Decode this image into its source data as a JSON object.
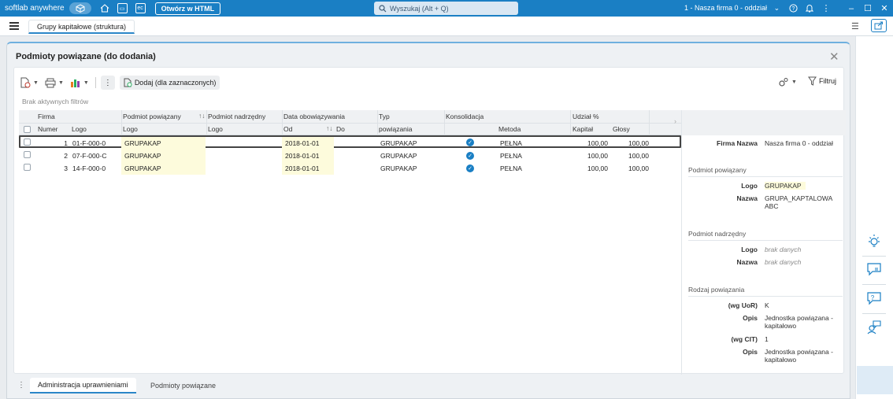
{
  "titlebar": {
    "brand": "softlab anywhere",
    "open_html": "Otwórz w HTML",
    "search_placeholder": "Wyszukaj (Alt + Q)",
    "company": "1 - Nasza firma 0 - oddział",
    "icons": [
      "cube-icon",
      "home-icon",
      "screen-icon",
      "ec-icon",
      "help-icon",
      "bell-icon",
      "more-icon",
      "minimize-icon",
      "maximize-icon",
      "close-icon"
    ]
  },
  "tabs": {
    "main_tab": "Grupy kapitałowe (struktura)"
  },
  "dialog": {
    "title": "Podmioty powiązane (do dodania)",
    "toolbar": {
      "add_label": "Dodaj (dla zaznaczonych)",
      "filter_label": "Filtruj"
    },
    "no_filters": "Brak aktywnych filtrów",
    "grid": {
      "header_top": {
        "firma": "Firma",
        "podmiot_powiazany": "Podmiot powiązany",
        "podmiot_nadrzedny": "Podmiot nadrzędny",
        "data_obowiazywania": "Data obowiązywania",
        "typ": "Typ",
        "konsolidacja": "Konsolidacja",
        "udzial": "Udział %"
      },
      "header_bottom": {
        "numer": "Numer",
        "logo1": "Logo",
        "logo2": "Logo",
        "logo3": "Logo",
        "od": "Od",
        "do": "Do",
        "powiazania": "powiązania",
        "metoda": "Metoda",
        "kapital": "Kapitał",
        "glosy": "Głosy"
      },
      "rows": [
        {
          "numer": "1",
          "firma_logo": "01-F-000-0",
          "pp_logo": "GRUPAKAP",
          "pn_logo": "",
          "od": "2018-01-01",
          "do": "",
          "typ": "GRUPAKAP",
          "konsolidacja": true,
          "metoda": "PEŁNA",
          "kapital": "100,00",
          "glosy": "100,00"
        },
        {
          "numer": "2",
          "firma_logo": "07-F-000-C",
          "pp_logo": "GRUPAKAP",
          "pn_logo": "",
          "od": "2018-01-01",
          "do": "",
          "typ": "GRUPAKAP",
          "konsolidacja": true,
          "metoda": "PEŁNA",
          "kapital": "100,00",
          "glosy": "100,00"
        },
        {
          "numer": "3",
          "firma_logo": "14-F-000-0",
          "pp_logo": "GRUPAKAP",
          "pn_logo": "",
          "od": "2018-01-01",
          "do": "",
          "typ": "GRUPAKAP",
          "konsolidacja": true,
          "metoda": "PEŁNA",
          "kapital": "100,00",
          "glosy": "100,00"
        }
      ]
    },
    "details": {
      "firma_nazwa_label": "Firma Nazwa",
      "firma_nazwa_value": "Nasza firma 0 - oddział",
      "sec_pp": "Podmiot powiązany",
      "pp_logo_label": "Logo",
      "pp_logo_value": "GRUPAKAP",
      "pp_nazwa_label": "Nazwa",
      "pp_nazwa_value": "GRUPA_KAPTALOWA ABC",
      "sec_pn": "Podmiot nadrzędny",
      "pn_logo_label": "Logo",
      "pn_logo_value": "brak danych",
      "pn_nazwa_label": "Nazwa",
      "pn_nazwa_value": "brak danych",
      "sec_rp": "Rodzaj powiązania",
      "uor_label": "(wg UoR)",
      "uor_value": "K",
      "opis1_label": "Opis",
      "opis1_value": "Jednostka powiązana - kapitałowo",
      "cit_label": "(wg CIT)",
      "cit_value": "1",
      "opis2_label": "Opis",
      "opis2_value": "Jednostka powiązana - kapitałowo"
    },
    "bottom_tabs": {
      "active": "Administracja uprawnieniami",
      "second": "Podmioty powiązane"
    }
  }
}
